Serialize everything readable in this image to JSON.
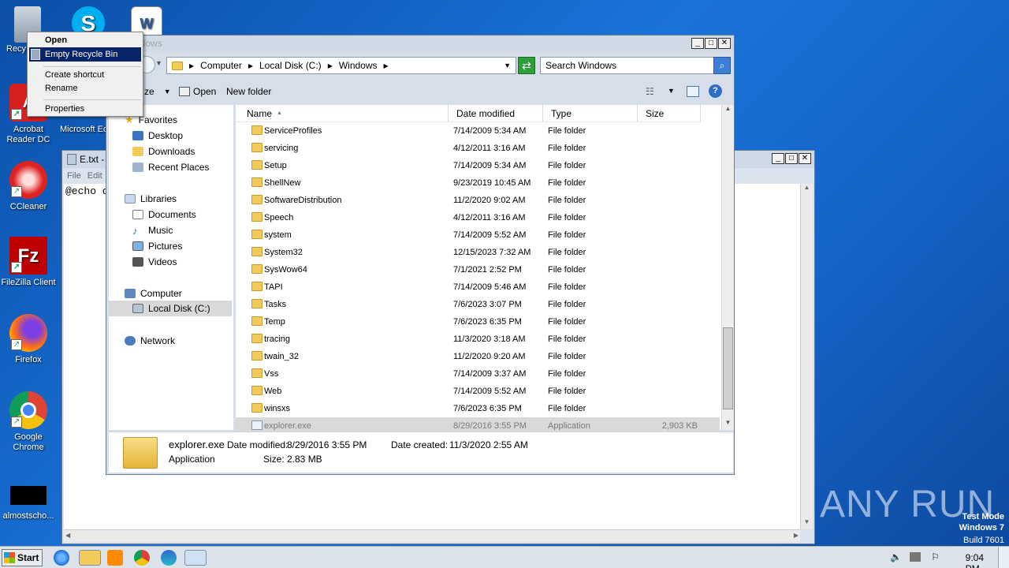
{
  "desktop": {
    "icons": [
      {
        "label": "Recy"
      },
      {
        "label": "Acrobat Reader DC"
      },
      {
        "label": "Microsoft Ed"
      },
      {
        "label": "CCleaner"
      },
      {
        "label": "FileZilla Client"
      },
      {
        "label": "Firefox"
      },
      {
        "label": "Google Chrome"
      },
      {
        "label": "almostscho..."
      }
    ]
  },
  "context_menu": {
    "items": [
      "Open",
      "Empty Recycle Bin",
      "Create shortcut",
      "Rename",
      "Properties"
    ]
  },
  "notepad": {
    "title": "E.txt -",
    "menu": [
      "File",
      "Edit"
    ],
    "content": "@echo o"
  },
  "explorer": {
    "title": "ndows",
    "breadcrumb": [
      "Computer",
      "Local Disk (C:)",
      "Windows"
    ],
    "search_placeholder": "Search Windows",
    "toolbar": {
      "organize": "ze",
      "open": "Open",
      "new_folder": "New folder"
    },
    "nav": {
      "favorites": "Favorites",
      "desktop": "Desktop",
      "downloads": "Downloads",
      "recent": "Recent Places",
      "libraries": "Libraries",
      "documents": "Documents",
      "music": "Music",
      "pictures": "Pictures",
      "videos": "Videos",
      "computer": "Computer",
      "local_disk": "Local Disk (C:)",
      "network": "Network"
    },
    "columns": {
      "name": "Name",
      "date": "Date modified",
      "type": "Type",
      "size": "Size"
    },
    "rows": [
      {
        "name": "ServiceProfiles",
        "date": "7/14/2009 5:34 AM",
        "type": "File folder",
        "size": ""
      },
      {
        "name": "servicing",
        "date": "4/12/2011 3:16 AM",
        "type": "File folder",
        "size": ""
      },
      {
        "name": "Setup",
        "date": "7/14/2009 5:34 AM",
        "type": "File folder",
        "size": ""
      },
      {
        "name": "ShellNew",
        "date": "9/23/2019 10:45 AM",
        "type": "File folder",
        "size": ""
      },
      {
        "name": "SoftwareDistribution",
        "date": "11/2/2020 9:02 AM",
        "type": "File folder",
        "size": ""
      },
      {
        "name": "Speech",
        "date": "4/12/2011 3:16 AM",
        "type": "File folder",
        "size": ""
      },
      {
        "name": "system",
        "date": "7/14/2009 5:52 AM",
        "type": "File folder",
        "size": ""
      },
      {
        "name": "System32",
        "date": "12/15/2023 7:32 AM",
        "type": "File folder",
        "size": ""
      },
      {
        "name": "SysWow64",
        "date": "7/1/2021 2:52 PM",
        "type": "File folder",
        "size": ""
      },
      {
        "name": "TAPI",
        "date": "7/14/2009 5:46 AM",
        "type": "File folder",
        "size": ""
      },
      {
        "name": "Tasks",
        "date": "7/6/2023 3:07 PM",
        "type": "File folder",
        "size": ""
      },
      {
        "name": "Temp",
        "date": "7/6/2023 6:35 PM",
        "type": "File folder",
        "size": ""
      },
      {
        "name": "tracing",
        "date": "11/3/2020 3:18 AM",
        "type": "File folder",
        "size": ""
      },
      {
        "name": "twain_32",
        "date": "11/2/2020 9:20 AM",
        "type": "File folder",
        "size": ""
      },
      {
        "name": "Vss",
        "date": "7/14/2009 3:37 AM",
        "type": "File folder",
        "size": ""
      },
      {
        "name": "Web",
        "date": "7/14/2009 5:52 AM",
        "type": "File folder",
        "size": ""
      },
      {
        "name": "winsxs",
        "date": "7/6/2023 6:35 PM",
        "type": "File folder",
        "size": ""
      },
      {
        "name": "explorer.exe",
        "date": "8/29/2016 3:55 PM",
        "type": "Application",
        "size": "2,903 KB"
      }
    ],
    "details": {
      "filename": "explorer.exe",
      "date_modified_label": "Date modified:",
      "date_modified": "8/29/2016 3:55 PM",
      "date_created_label": "Date created:",
      "date_created": "11/3/2020 2:55 AM",
      "type": "Application",
      "size_label": "Size:",
      "size": "2.83 MB"
    }
  },
  "taskbar": {
    "start": "Start",
    "clock": "9:04 PM"
  },
  "watermark": {
    "brand": "ANY RUN",
    "line1": "Test Mode",
    "line2": "Windows 7",
    "line3": "Build 7601"
  }
}
